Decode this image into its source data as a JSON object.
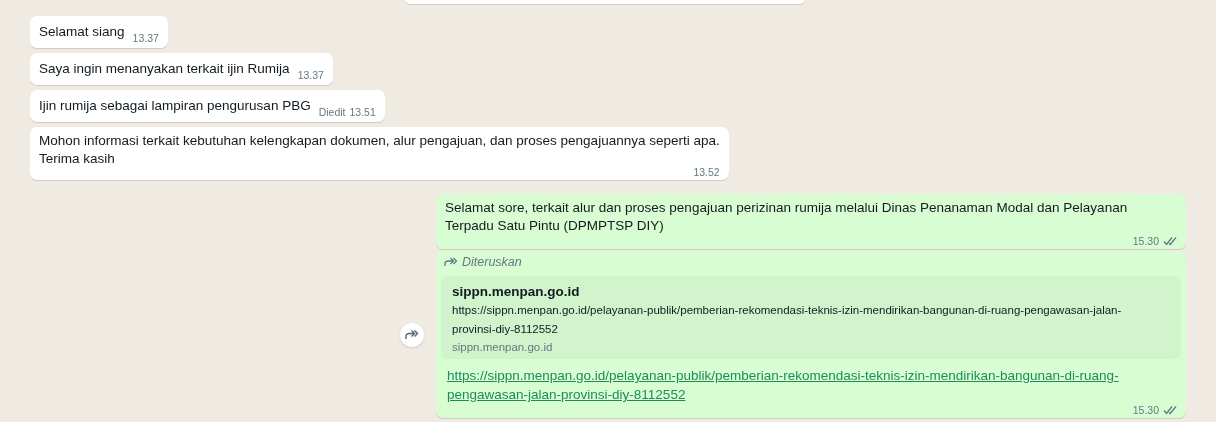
{
  "messages": [
    {
      "kind": "incoming",
      "text": "Selamat siang",
      "time": "13.37"
    },
    {
      "kind": "incoming",
      "text": "Saya ingin menanyakan terkait ijin Rumija",
      "time": "13.37"
    },
    {
      "kind": "incoming",
      "text": "Ijin rumija sebagai lampiran pengurusan PBG",
      "edited_label": "Diedit",
      "time": "13.51"
    },
    {
      "kind": "incoming",
      "text": "Mohon informasi terkait kebutuhan kelengkapan dokumen, alur pengajuan, dan proses pengajuannya seperti apa.\nTerima kasih",
      "time": "13.52"
    },
    {
      "kind": "outgoing",
      "text": "Selamat sore, terkait alur dan proses pengajuan perizinan rumija melalui Dinas Penanaman Modal dan Pelayanan Terpadu Satu Pintu (DPMPTSP DIY)",
      "time": "15.30",
      "read": false
    },
    {
      "kind": "forwarded",
      "forwarded_label": "Diteruskan",
      "preview": {
        "title": "sippn.menpan.go.id",
        "description": "https://sippn.menpan.go.id/pelayanan-publik/pemberian-rekomendasi-teknis-izin-mendirikan-bangunan-di-ruang-pengawasan-jalan-provinsi-diy-8112552",
        "domain": "sippn.menpan.go.id"
      },
      "link": "https://sippn.menpan.go.id/pelayanan-publik/pemberian-rekomendasi-teknis-izin-mendirikan-bangunan-di-ruang-pengawasan-jalan-provinsi-diy-8112552",
      "time": "15.30",
      "read": false
    }
  ]
}
